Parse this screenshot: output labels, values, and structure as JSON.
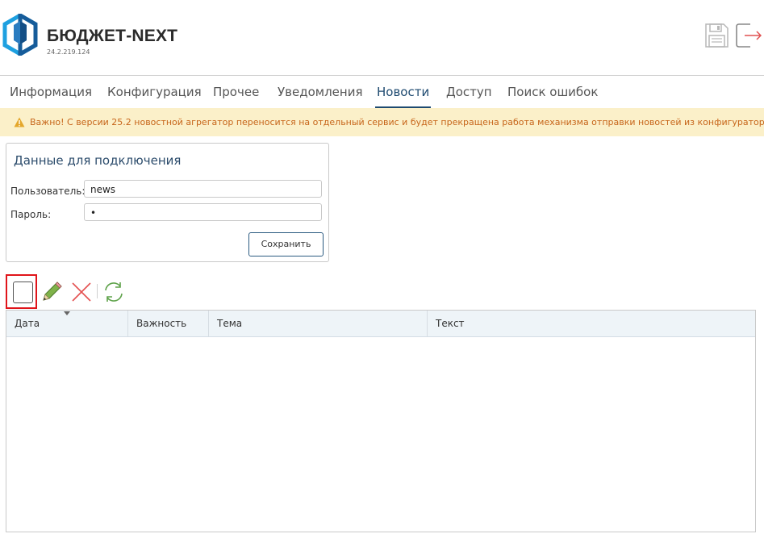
{
  "header": {
    "app_title": "БЮДЖЕТ-NEXT",
    "version": "24.2.219.124",
    "logo_icon": "hexagon-shield-logo",
    "save_icon": "save-icon",
    "exit_icon": "exit-icon"
  },
  "tabs": [
    {
      "label": "Информация"
    },
    {
      "label": "Конфигурация"
    },
    {
      "label": "Прочее"
    },
    {
      "label": "Уведомления"
    },
    {
      "label": "Новости",
      "active": true
    },
    {
      "label": "Доступ"
    },
    {
      "label": "Поиск ошибок"
    }
  ],
  "notice": {
    "icon": "warning-icon",
    "text": "Важно! С версии 25.2 новостной агрегатор переносится на отдельный сервис и будет прекращена работа механизма отправки новостей из конфигуратора."
  },
  "connection": {
    "title": "Данные для подключения",
    "user_label": "Пользователь:",
    "user_value": "news",
    "password_label": "Пароль:",
    "password_value": "•",
    "save_label": "Сохранить"
  },
  "toolbar": {
    "new_icon": "new-document-icon",
    "edit_icon": "pencil-icon",
    "delete_icon": "delete-cross-icon",
    "refresh_icon": "refresh-icon"
  },
  "grid": {
    "columns": [
      "Дата",
      "Важность",
      "Тема",
      "Текст"
    ],
    "rows": []
  },
  "colors": {
    "accent": "#1e4a70",
    "notice_bg": "#fbf0c9",
    "notice_text": "#c7661b",
    "highlight": "#e0141a"
  }
}
